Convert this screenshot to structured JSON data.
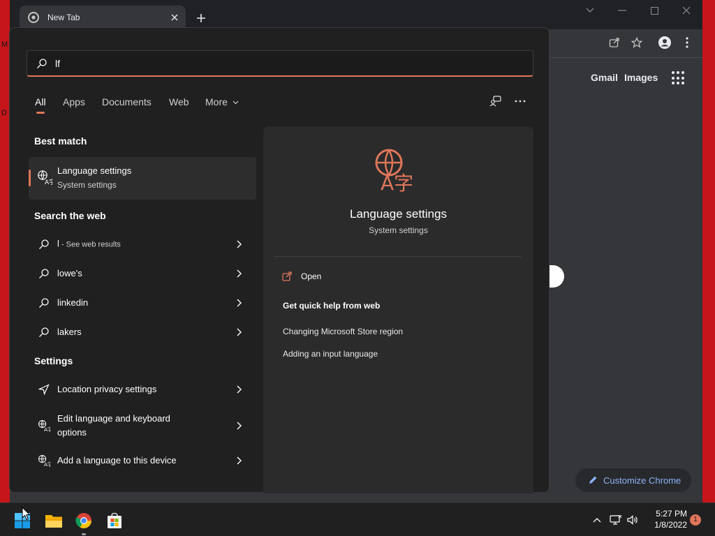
{
  "desktop": {
    "left_glyph_1": "M",
    "left_glyph_2": "D"
  },
  "browser": {
    "tab_title": "New Tab",
    "top_links": {
      "gmail": "Gmail",
      "images": "Images"
    },
    "customize_label": "Customize Chrome"
  },
  "search": {
    "query": "lf",
    "tabs": [
      "All",
      "Apps",
      "Documents",
      "Web",
      "More"
    ],
    "active_tab": "All",
    "sections": {
      "best_match": "Best match",
      "search_web": "Search the web",
      "settings": "Settings"
    },
    "best_match": {
      "title": "Language settings",
      "subtitle": "System settings"
    },
    "web_results": [
      {
        "prefix": "l",
        "suffix": " - See web results"
      },
      {
        "label": "lowe's"
      },
      {
        "label": "linkedin"
      },
      {
        "label": "lakers"
      }
    ],
    "settings_results": [
      {
        "label": "Location privacy settings",
        "icon": "navigation-arrow-icon"
      },
      {
        "label": "Edit language and keyboard options",
        "icon": "language-icon"
      },
      {
        "label": "Add a language to this device",
        "icon": "language-icon"
      }
    ],
    "preview": {
      "title": "Language settings",
      "subtitle": "System settings",
      "open_label": "Open",
      "help_title": "Get quick help from web",
      "links": [
        "Changing Microsoft Store region",
        "Adding an input language"
      ]
    }
  },
  "taskbar": {
    "time": "5:27 PM",
    "date": "1/8/2022",
    "notification_count": "1"
  },
  "colors": {
    "accent": "#e0765a",
    "flyout_bg": "#202020",
    "preview_bg": "#2b2b2b",
    "chrome_link": "#8ab4f8"
  }
}
